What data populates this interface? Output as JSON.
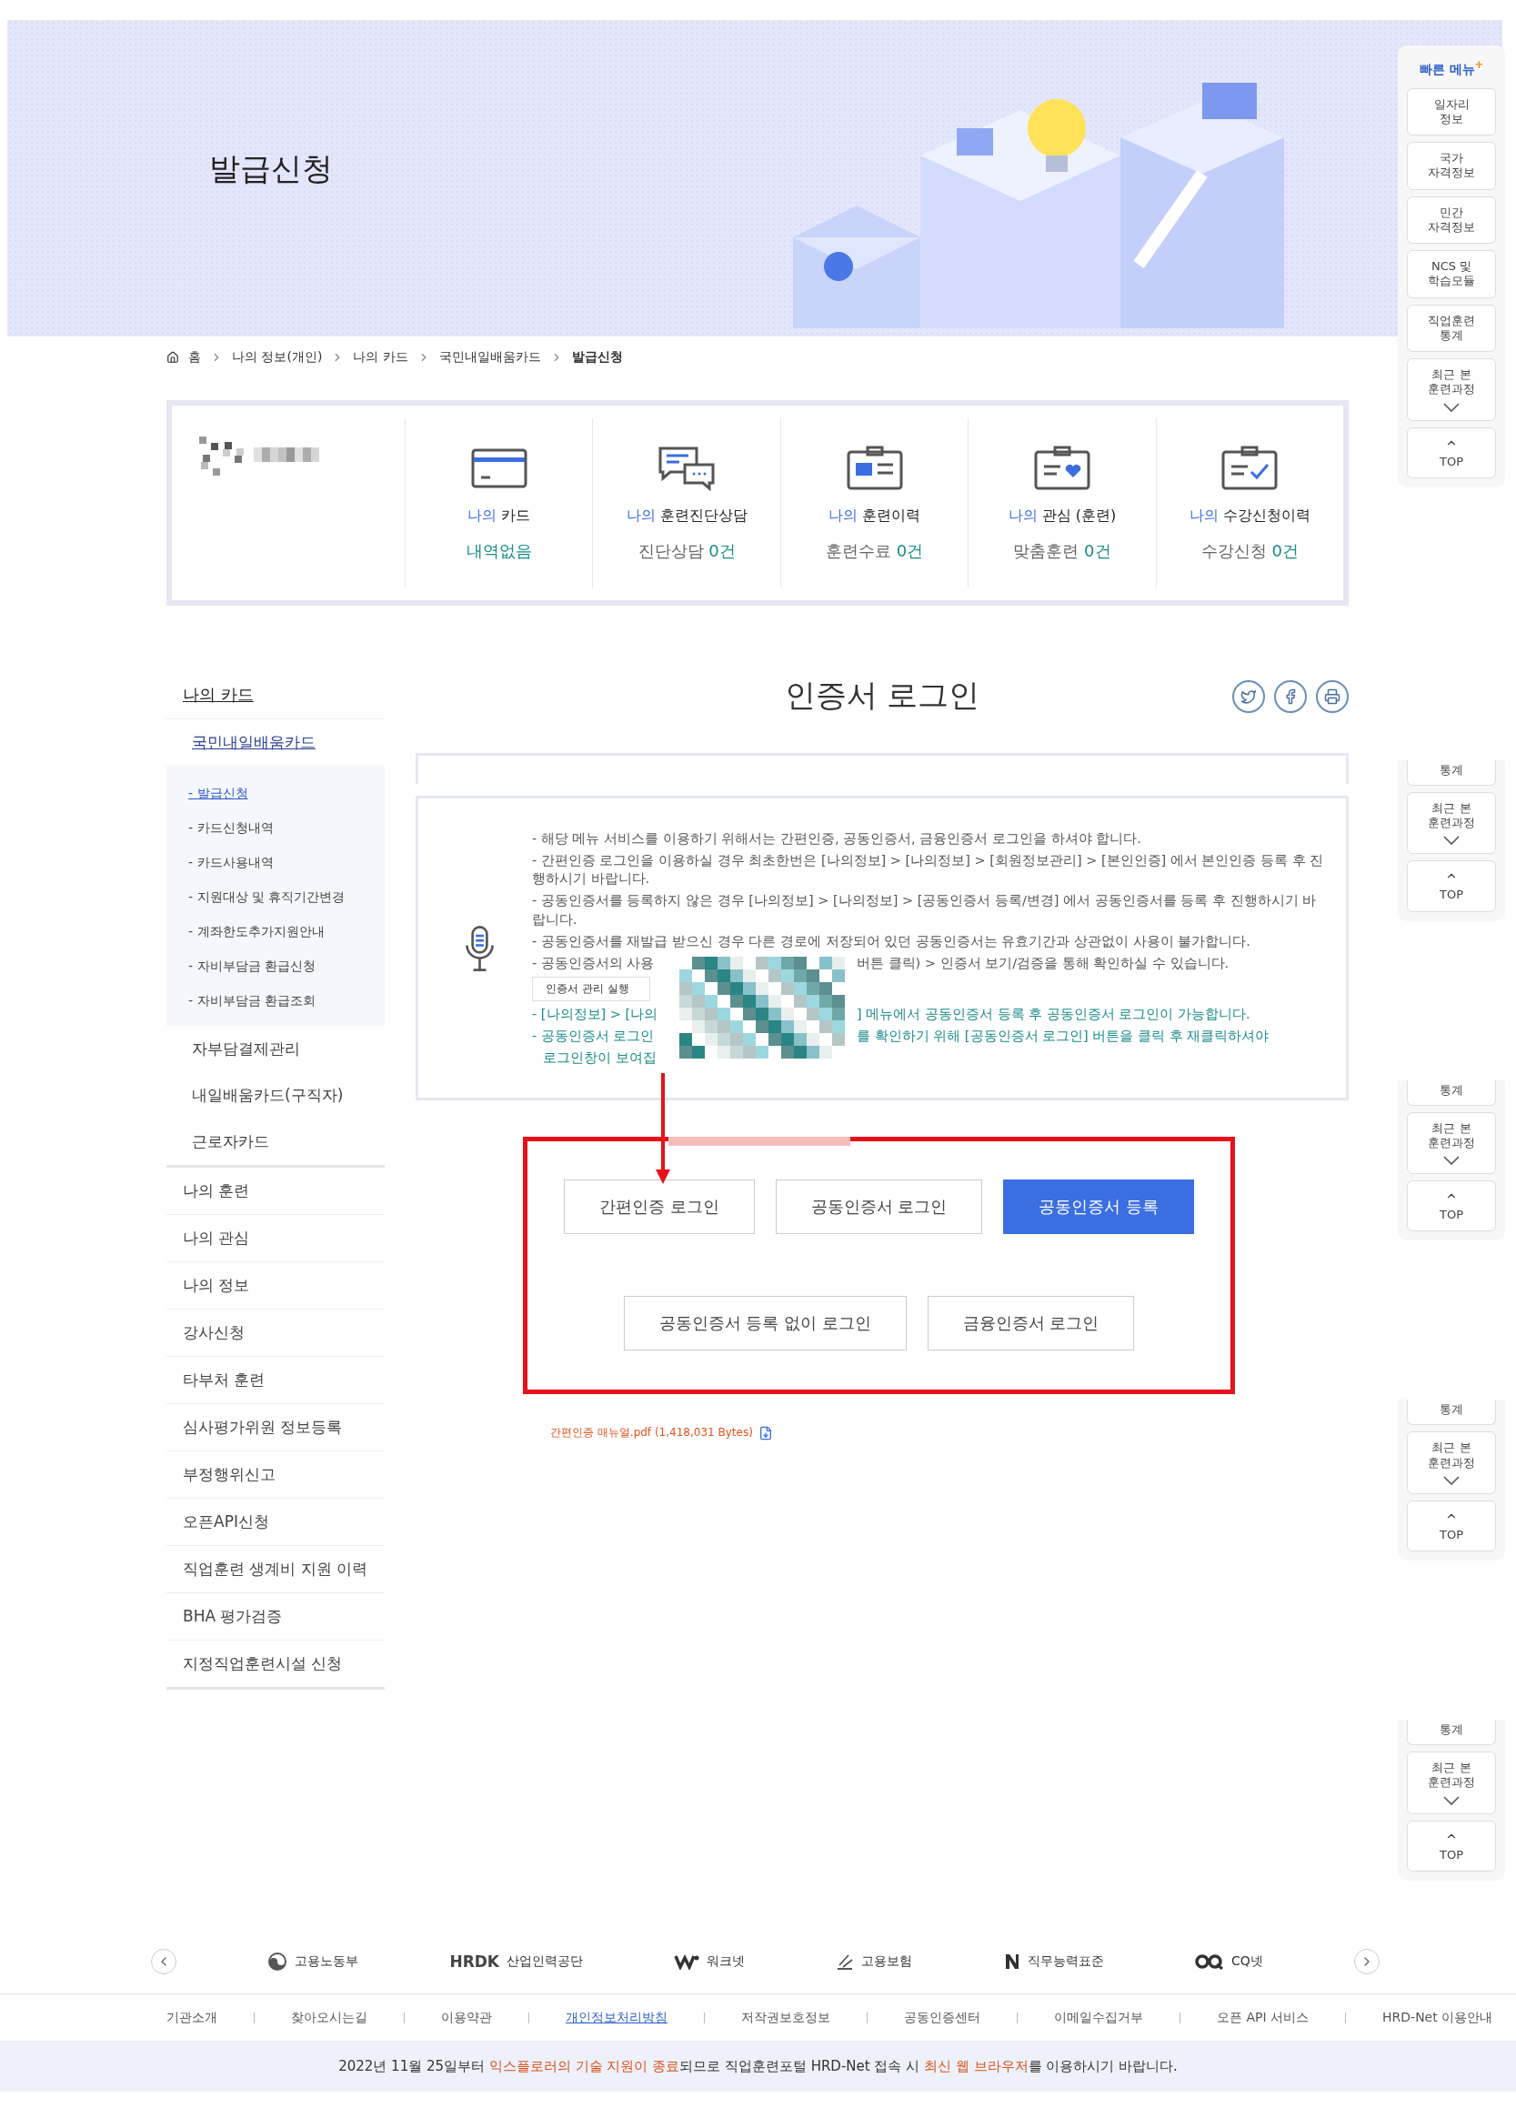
{
  "banner": {
    "title": "발급신청"
  },
  "breadcrumb": [
    "홈",
    "나의 정보(개인)",
    "나의 카드",
    "국민내일배움카드",
    "발급신청"
  ],
  "summary": {
    "items": [
      {
        "kind": "card",
        "prefix": "나의",
        "label": "카드",
        "count": "내역없음"
      },
      {
        "kind": "chat",
        "prefix": "나의",
        "label": "훈련진단상담",
        "caption": "진단상담",
        "count": "0건"
      },
      {
        "kind": "history",
        "prefix": "나의",
        "label": "훈련이력",
        "caption": "훈련수료",
        "count": "0건"
      },
      {
        "kind": "heart",
        "prefix": "나의",
        "label": "관심 (훈련)",
        "caption": "맞춤훈련",
        "count": "0건"
      },
      {
        "kind": "check",
        "prefix": "나의",
        "label": "수강신청이력",
        "caption": "수강신청",
        "count": "0건"
      }
    ]
  },
  "sidebar": {
    "title": "나의 카드",
    "items": [
      {
        "label": "국민내일배움카드",
        "selected": true,
        "children": [
          {
            "label": "- 발급신청",
            "selected": true
          },
          {
            "label": "- 카드신청내역",
            "selected": false
          },
          {
            "label": "- 카드사용내역",
            "selected": false
          },
          {
            "label": "- 지원대상 및 휴직기간변경",
            "selected": false
          },
          {
            "label": "- 계좌한도추가지원안내",
            "selected": false
          },
          {
            "label": "- 자비부담금 환급신청",
            "selected": false
          },
          {
            "label": "- 자비부담금 환급조회",
            "selected": false
          }
        ]
      },
      {
        "label": "자부담결제관리",
        "selected": false
      },
      {
        "label": "내일배움카드(구직자)",
        "selected": false
      },
      {
        "label": "근로자카드",
        "selected": false
      }
    ],
    "sections": [
      "나의 훈련",
      "나의 관심",
      "나의 정보",
      "강사신청",
      "타부처 훈련",
      "심사평가위원 정보등록",
      "부정행위신고",
      "오픈API신청",
      "직업훈련 생계비 지원 이력",
      "BHA 평가검증",
      "지정직업훈련시설 신청"
    ]
  },
  "content": {
    "title": "인증서 로그인",
    "notices": [
      {
        "highlight": false,
        "parts": [
          "- 해당 메뉴 서비스를 이용하기 위해서는 간편인증, 공동인증서, 금융인증서 로그인을 하셔야 합니다."
        ]
      },
      {
        "highlight": false,
        "parts": [
          "- 간편인증 로그인을 이용하실 경우 최초한번은 [나의정보] > [나의정보] > [회원정보관리] > [본인인증] 에서 본인인증 등록 후 진행하시기 바랍니다."
        ]
      },
      {
        "highlight": false,
        "parts": [
          "- 공동인증서를 등록하지 않은 경우 [나의정보] > [나의정보] > [공동인증서 등록/변경] 에서 공동인증서를 등록 후 진행하시기 바랍니다."
        ]
      },
      {
        "highlight": false,
        "parts": [
          "- 공동인증서를 재발급 받으신 경우 다른 경로에 저장되어 있던 공동인증서는 유효기간과 상관없이 사용이 불가합니다."
        ]
      },
      {
        "highlight": false,
        "parts": [
          "- 공동인증서의 사용",
          "버튼 클릭) > 인증서 보기/검증을 통해 확인하실 수 있습니다."
        ]
      },
      {
        "highlight": true,
        "parts": [
          "- [나의정보] > [나의",
          "] 메뉴에서 공동인증서 등록 후 공동인증서 로그인이 가능합니다."
        ]
      },
      {
        "highlight": true,
        "parts": [
          "- 공동인증서 로그인",
          "를 확인하기 위해 [공동인증서 로그인] 버튼을 클릭 후 재클릭하셔야"
        ]
      },
      {
        "highlight": true,
        "parts": [
          "로그인창이 보여집"
        ]
      }
    ],
    "cert_button": "인증서 관리 실행",
    "buttons": [
      [
        {
          "label": "간편인증 로그인",
          "primary": false
        },
        {
          "label": "공동인증서 로그인",
          "primary": false
        },
        {
          "label": "공동인증서 등록",
          "primary": true
        }
      ],
      [
        {
          "label": "공동인증서 등록 없이 로그인",
          "primary": false
        },
        {
          "label": "금융인증서 로그인",
          "primary": false
        }
      ]
    ],
    "download": "간편인증 매뉴얼.pdf (1,418,031 Bytes)"
  },
  "quick_menu": {
    "title": "빠른 메뉴",
    "plus": "+",
    "items": [
      "일자리\n정보",
      "국가\n자격정보",
      "민간\n자격정보",
      "NCS 및\n학습모듈",
      "직업훈련\n통계"
    ],
    "recent": "최근 본\n훈련과정",
    "top": "TOP",
    "fragments": [
      {
        "partial": "통계",
        "recent": "최근 본\n훈련과정",
        "top": "TOP"
      },
      {
        "partial": "통계",
        "recent": "최근 본\n훈련과정",
        "top": "TOP"
      },
      {
        "partial": "통계",
        "recent": "최근 본\n훈련과정",
        "top": "TOP"
      },
      {
        "partial": "통계",
        "recent": "최근 본\n훈련과정",
        "top": "TOP"
      }
    ]
  },
  "footer": {
    "logos": [
      {
        "kind": "moel",
        "label": "고용노동부"
      },
      {
        "kind": "hrdk",
        "mark": "HRDK",
        "label": "산업인력공단"
      },
      {
        "kind": "worknet",
        "label": "워크넷"
      },
      {
        "kind": "insurance",
        "label": "고용보험"
      },
      {
        "kind": "ncs",
        "label": "직무능력표준"
      },
      {
        "kind": "cq",
        "label": "CQ넷"
      }
    ],
    "links": [
      {
        "label": "기관소개",
        "emphasis": false
      },
      {
        "label": "찾아오시는길",
        "emphasis": false
      },
      {
        "label": "이용약관",
        "emphasis": false
      },
      {
        "label": "개인정보처리방침",
        "emphasis": true
      },
      {
        "label": "저작권보호정보",
        "emphasis": false
      },
      {
        "label": "공동인증센터",
        "emphasis": false
      },
      {
        "label": "이메일수집거부",
        "emphasis": false
      },
      {
        "label": "오픈 API 서비스",
        "emphasis": false
      },
      {
        "label": "HRD-Net 이용안내",
        "emphasis": false
      }
    ],
    "notice": [
      {
        "text": "2022년 11월 25일부터 ",
        "highlight": false
      },
      {
        "text": "익스플로러의 기술 지원이 종료",
        "highlight": true
      },
      {
        "text": "되므로 직업훈련포털 HRD-Net 접속 시 ",
        "highlight": false
      },
      {
        "text": "최신 웹 브라우저",
        "highlight": true
      },
      {
        "text": "를 이용하시기 바랍니다.",
        "highlight": false
      }
    ]
  }
}
